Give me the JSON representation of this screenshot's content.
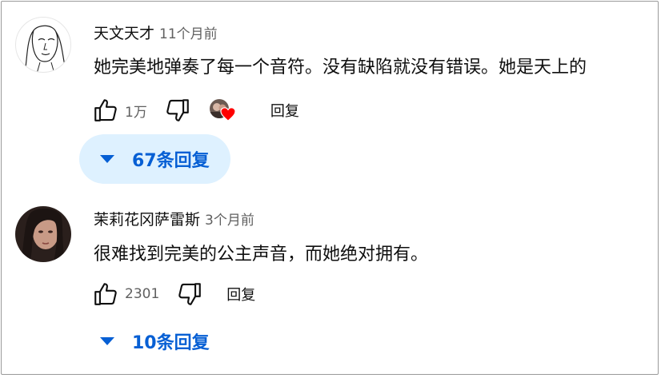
{
  "colors": {
    "link_blue": "#065fd4",
    "toggle_bg": "#def1ff",
    "meta_grey": "#606060",
    "heart_red": "#ff0000"
  },
  "comments": [
    {
      "author": "天文天才",
      "time": "11个月前",
      "text": "她完美地弹奏了每一个音符。没有缺陷就没有错误。她是天上的",
      "likes": "1万",
      "reply_label": "回复",
      "replies_label": "67条回复",
      "creator_hearted": true,
      "avatar_icon": "sketch-face-avatar",
      "like_icon": "thumb-up-icon",
      "dislike_icon": "thumb-down-icon"
    },
    {
      "author": "茉莉花冈萨雷斯",
      "time": "3个月前",
      "text": "很难找到完美的公主声音，而她绝对拥有。",
      "likes": "2301",
      "reply_label": "回复",
      "replies_label": "10条回复",
      "creator_hearted": false,
      "avatar_icon": "photo-avatar",
      "like_icon": "thumb-up-icon",
      "dislike_icon": "thumb-down-icon"
    }
  ]
}
